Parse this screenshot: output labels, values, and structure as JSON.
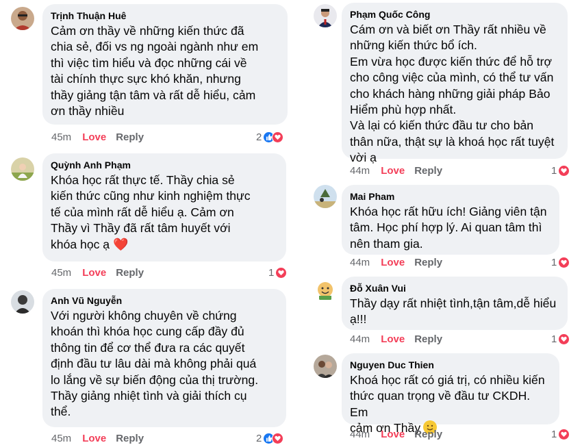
{
  "comments": [
    {
      "name": "Trịnh Thuận Huê",
      "text": "Cảm ơn thầy về những kiến thức đã\nchia sẻ, đối vs ng ngoài ngành như em\nthì việc tìm hiểu và đọc những cái về\ntài chính thực sực khó khăn, nhưng\nthầy giảng tận tâm và rất dễ hiểu, cảm\nơn thầy nhiều",
      "time": "45m",
      "love": "Love",
      "reply": "Reply",
      "reactions": "2"
    },
    {
      "name": "Quỳnh Anh Phạm",
      "text": "Khóa học rất thực tế. Thầy chia sẻ\nkiến thức cũng như kinh nghiệm thực\ntế của mình rất dễ hiểu ạ. Cảm ơn\nThầy vì Thầy đã rất tâm huyết với\nkhóa học ạ",
      "emoji": "❤️",
      "time": "45m",
      "love": "Love",
      "reply": "Reply",
      "reactions": "1"
    },
    {
      "name": "Anh Vũ Nguyễn",
      "text": "Với người không chuyên về chứng\nkhoán thì khóa học cung cấp đầy đủ\nthông tin để cơ thể đưa ra các quyết\nđịnh đầu tư lâu dài mà không phải quá\nlo lắng về sự biến động của thị trường.\nThầy giảng nhiệt tình và giải thích cụ\nthể.",
      "time": "45m",
      "love": "Love",
      "reply": "Reply",
      "reactions": "2"
    },
    {
      "name": "Phạm Quốc Công",
      "text": "Cám ơn và biết ơn Thầy rất nhiều về\nnhững kiến thức bổ ích.\nEm vừa học được kiến thức để hỗ trợ\ncho công việc của mình, có thể tư vấn\ncho khách hàng những giải pháp Bảo\nHiểm phù hợp nhất.\nVà lại có kiến thức đầu tư cho bản\nthân nữa, thật sự là khoá học rất tuyệt\nvời ạ",
      "time": "44m",
      "love": "Love",
      "reply": "Reply",
      "reactions": "1"
    },
    {
      "name": "Mai Pham",
      "text": "Khóa học rất hữu ích! Giảng viên tận\ntâm. Học phí hợp lý. Ai quan tâm thì\nnên tham gia.",
      "time": "44m",
      "love": "Love",
      "reply": "Reply",
      "reactions": "1"
    },
    {
      "name": "Đỗ Xuân Vui",
      "text": "Thầy dạy rất nhiệt tình,tận tâm,dễ hiểu\nạ!!!",
      "time": "44m",
      "love": "Love",
      "reply": "Reply",
      "reactions": "1"
    },
    {
      "name": "Nguyen Duc Thien",
      "text": "Khoá học rất có giá trị, có nhiều kiến\nthức quan trọng về đầu tư CKDH. Em\ncảm ơn Thầy",
      "time": "44m",
      "love": "Love",
      "reply": "Reply",
      "reactions": "1"
    }
  ],
  "colors": {
    "bubble": "#eff1f4",
    "love": "#f33e58",
    "like": "#1877f2",
    "meta": "#65676b"
  }
}
